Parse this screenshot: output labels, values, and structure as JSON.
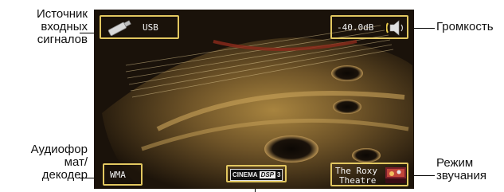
{
  "callouts": {
    "input_source": "Источник\nвходных\nсигналов",
    "volume": "Громкость",
    "audio_format": "Аудиофор\nмат/\nдекодер",
    "sound_mode": "Режим\nзвучания"
  },
  "screen": {
    "input_label": "USB",
    "volume_value": "-40.0dB",
    "format_value": "WMA",
    "dsp_badge_left": "CINEMA",
    "dsp_badge_right": "DSP",
    "dsp_badge_num": "3",
    "sound_program_line1": "The Roxy",
    "sound_program_line2": "Theatre"
  },
  "icons": {
    "input": "usb-stick-icon",
    "volume": "speaker-icon",
    "program": "theatre-thumbnail-icon"
  },
  "colors": {
    "box_border": "#e2c760",
    "background": "#ffffff"
  }
}
